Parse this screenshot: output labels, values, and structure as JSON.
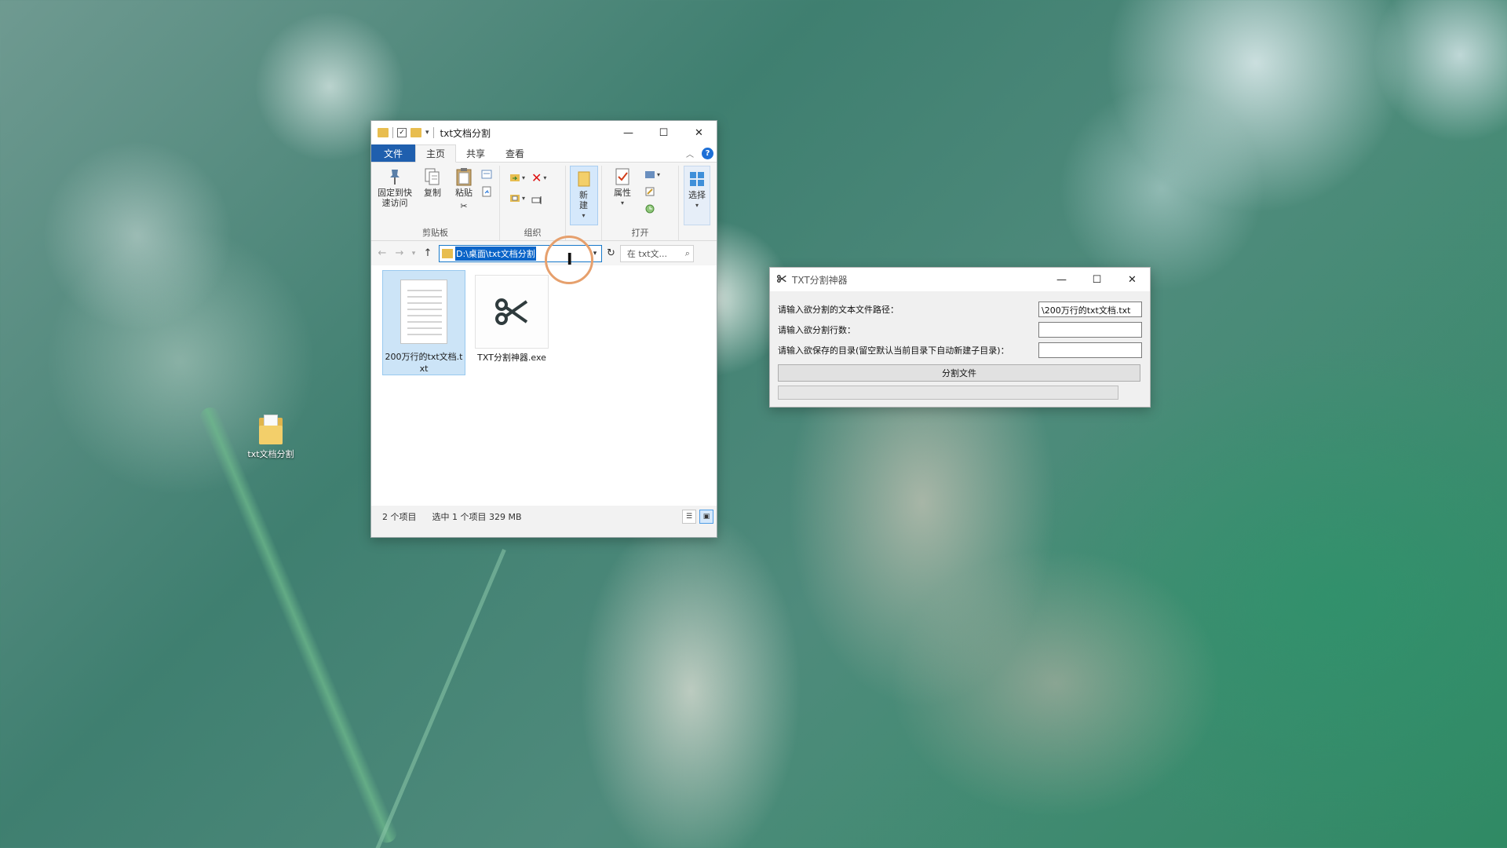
{
  "desktop": {
    "icon_label": "txt文档分割"
  },
  "explorer": {
    "title": "txt文档分割",
    "window_buttons": {
      "minimize": "—",
      "maximize": "☐",
      "close": "✕"
    },
    "tabs": {
      "file": "文件",
      "home": "主页",
      "share": "共享",
      "view": "查看"
    },
    "help": "?",
    "ribbon": {
      "pin": "固定到快\n速访问",
      "copy": "复制",
      "paste": "粘贴",
      "new": "新\n建",
      "properties": "属性",
      "select": "选择",
      "group_clipboard": "剪贴板",
      "group_organize": "组织",
      "group_open": "打开"
    },
    "address": {
      "path": "D:\\桌面\\txt文档分割"
    },
    "search": {
      "placeholder": "在 txt文..."
    },
    "files": [
      {
        "name": "200万行的txt文档.txt",
        "selected": true
      },
      {
        "name": "TXT分割神器.exe",
        "selected": false
      }
    ],
    "status": {
      "count": "2 个项目",
      "selection": "选中 1 个项目  329 MB"
    }
  },
  "dialog": {
    "title": "TXT分割神器",
    "window_buttons": {
      "minimize": "—",
      "maximize": "☐",
      "close": "✕"
    },
    "fields": [
      {
        "label": "请输入欲分割的文本文件路径：",
        "value": "\\200万行的txt文档.txt"
      },
      {
        "label": "请输入欲分割行数：",
        "value": ""
      },
      {
        "label": "请输入欲保存的目录(留空默认当前目录下自动新建子目录)：",
        "value": ""
      }
    ],
    "split_button": "分割文件",
    "progress": 0
  },
  "colors": {
    "file_tab": "#1f5fae",
    "selection": "#cce4f7",
    "address_highlight": "#0a64c8",
    "cursor_ring": "#e6a06d"
  }
}
